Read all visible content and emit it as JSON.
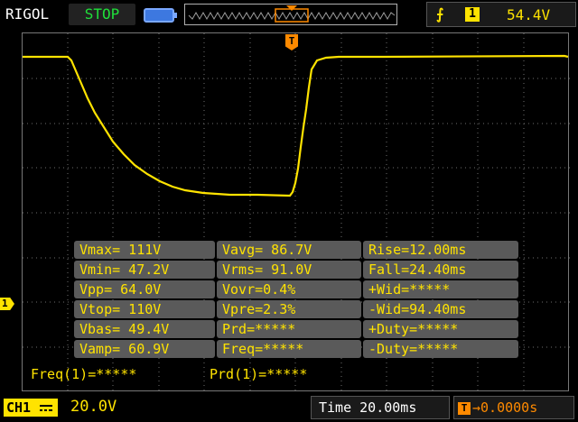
{
  "top": {
    "brand": "RIGOL",
    "run_state": "STOP",
    "trigger_source": "1",
    "trigger_level": "54.4V"
  },
  "markers": {
    "channel": "1",
    "trigger": "T"
  },
  "measurements": [
    [
      "Vmax= 111V",
      "Vavg= 86.7V",
      "Rise=12.00ms"
    ],
    [
      "Vmin= 47.2V",
      "Vrms= 91.0V",
      "Fall=24.40ms"
    ],
    [
      "Vpp= 64.0V",
      "Vovr=0.4%",
      "+Wid=*****"
    ],
    [
      "Vtop= 110V",
      "Vpre=2.3%",
      "-Wid=94.40ms"
    ],
    [
      "Vbas= 49.4V",
      "Prd=*****",
      "+Duty=*****"
    ],
    [
      "Vamp= 60.9V",
      "Freq=*****",
      "-Duty=*****"
    ]
  ],
  "counters": {
    "freq": "Freq(1)=*****",
    "prd": "Prd(1)=*****"
  },
  "bottom": {
    "channel": "CH1",
    "volts_div": "20.0V",
    "time_div": "Time 20.00ms",
    "offset_badge": "T",
    "offset": "0.0000s"
  },
  "colors": {
    "channel1": "#ffe300",
    "trigger": "#ff8a00",
    "run_state": "#1fe03a"
  }
}
